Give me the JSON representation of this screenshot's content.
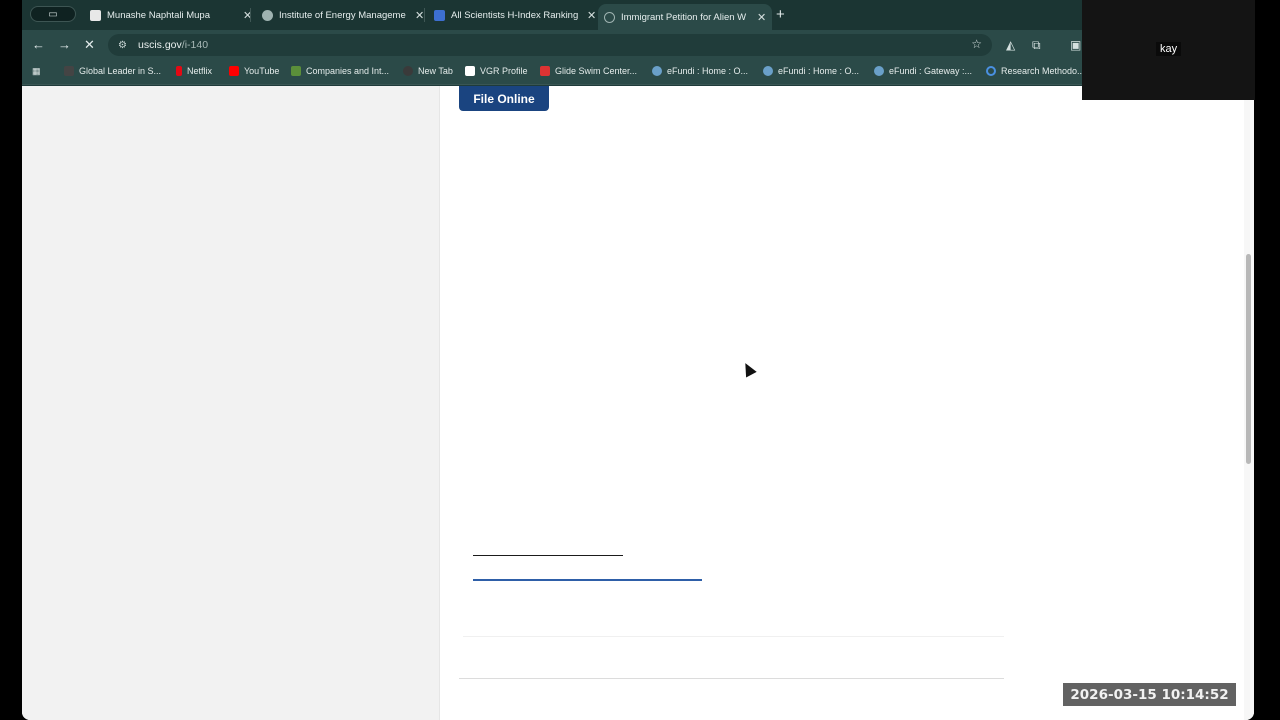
{
  "tabs": [
    {
      "title": "Munashe Naphtali Mupa",
      "favicon_color": "#e8e8e8",
      "active": false
    },
    {
      "title": "Institute of Energy Manageme",
      "favicon_color": "#9fb3b1",
      "active": false
    },
    {
      "title": "All Scientists H-Index Ranking",
      "favicon_color": "#3d6fd1",
      "active": false
    },
    {
      "title": "Immigrant Petition for Alien W",
      "favicon_color": "#9fb3b1",
      "active": true
    }
  ],
  "toolbar": {
    "url_host": "uscis.gov",
    "url_path": "/i-140"
  },
  "bookmarks": [
    {
      "label": "Global Leader in S...",
      "color": "#444"
    },
    {
      "label": "Netflix",
      "color": "#e50914"
    },
    {
      "label": "YouTube",
      "color": "#ff0000"
    },
    {
      "label": "Companies and Int...",
      "color": "#5b8f3a"
    },
    {
      "label": "New Tab",
      "color": "#3a3a3a"
    },
    {
      "label": "VGR Profile",
      "color": "#ffffff"
    },
    {
      "label": "Glide Swim Center...",
      "color": "#d33"
    },
    {
      "label": "eFundi : Home : O...",
      "color": "#6aa0c9"
    },
    {
      "label": "eFundi : Home : O...",
      "color": "#6aa0c9"
    },
    {
      "label": "eFundi : Gateway :...",
      "color": "#6aa0c9"
    },
    {
      "label": "Research Methodo...",
      "color": "#4a90e2"
    }
  ],
  "page": {
    "file_online_label": "File Online"
  },
  "overlay": {
    "webcam_label": "kay",
    "timestamp": "2026-03-15  10:14:52"
  }
}
